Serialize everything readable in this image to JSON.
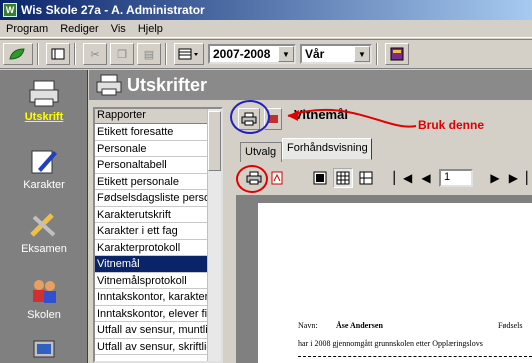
{
  "window": {
    "title": "Wis Skole 27a  -  A. Administrator"
  },
  "menu": [
    "Program",
    "Rediger",
    "Vis",
    "Hjelp"
  ],
  "toolbar": {
    "year": "2007-2008",
    "term": "Vår"
  },
  "sidebar": {
    "items": [
      "Utskrift",
      "Karakter",
      "Eksamen",
      "Skolen"
    ]
  },
  "header": {
    "title": "Utskrifter"
  },
  "reports": {
    "header": "Rapporter",
    "items": [
      "Etikett foresatte",
      "Personale",
      "Personaltabell",
      "Etikett personale",
      "Fødselsdagsliste person",
      "Karakterutskrift",
      "Karakter i ett fag",
      "Karakterprotokoll",
      "Vitnemål",
      "Vitnemålsprotokoll",
      "Inntakskontor, karakter",
      "Inntakskontor, elever fil",
      "Utfall av sensur, muntlig",
      "Utfall av sensur, skriftlig"
    ],
    "selected": "Vitnemål"
  },
  "report": {
    "title": "Vitnemål",
    "annotation": "Bruk denne"
  },
  "tabs": [
    "Utvalg",
    "Forhåndsvisning"
  ],
  "preview": {
    "page": "1"
  },
  "document": {
    "name_label": "Navn:",
    "name_value": "Åse Andersen",
    "birth_label": "Fødsels",
    "line1": "har i 2008 gjennomgått grunnskolen etter Opplæringslovs"
  },
  "colors": {
    "annotation": "#e00000",
    "highlight_blue": "#2020c0",
    "selection": "#0a246a"
  }
}
